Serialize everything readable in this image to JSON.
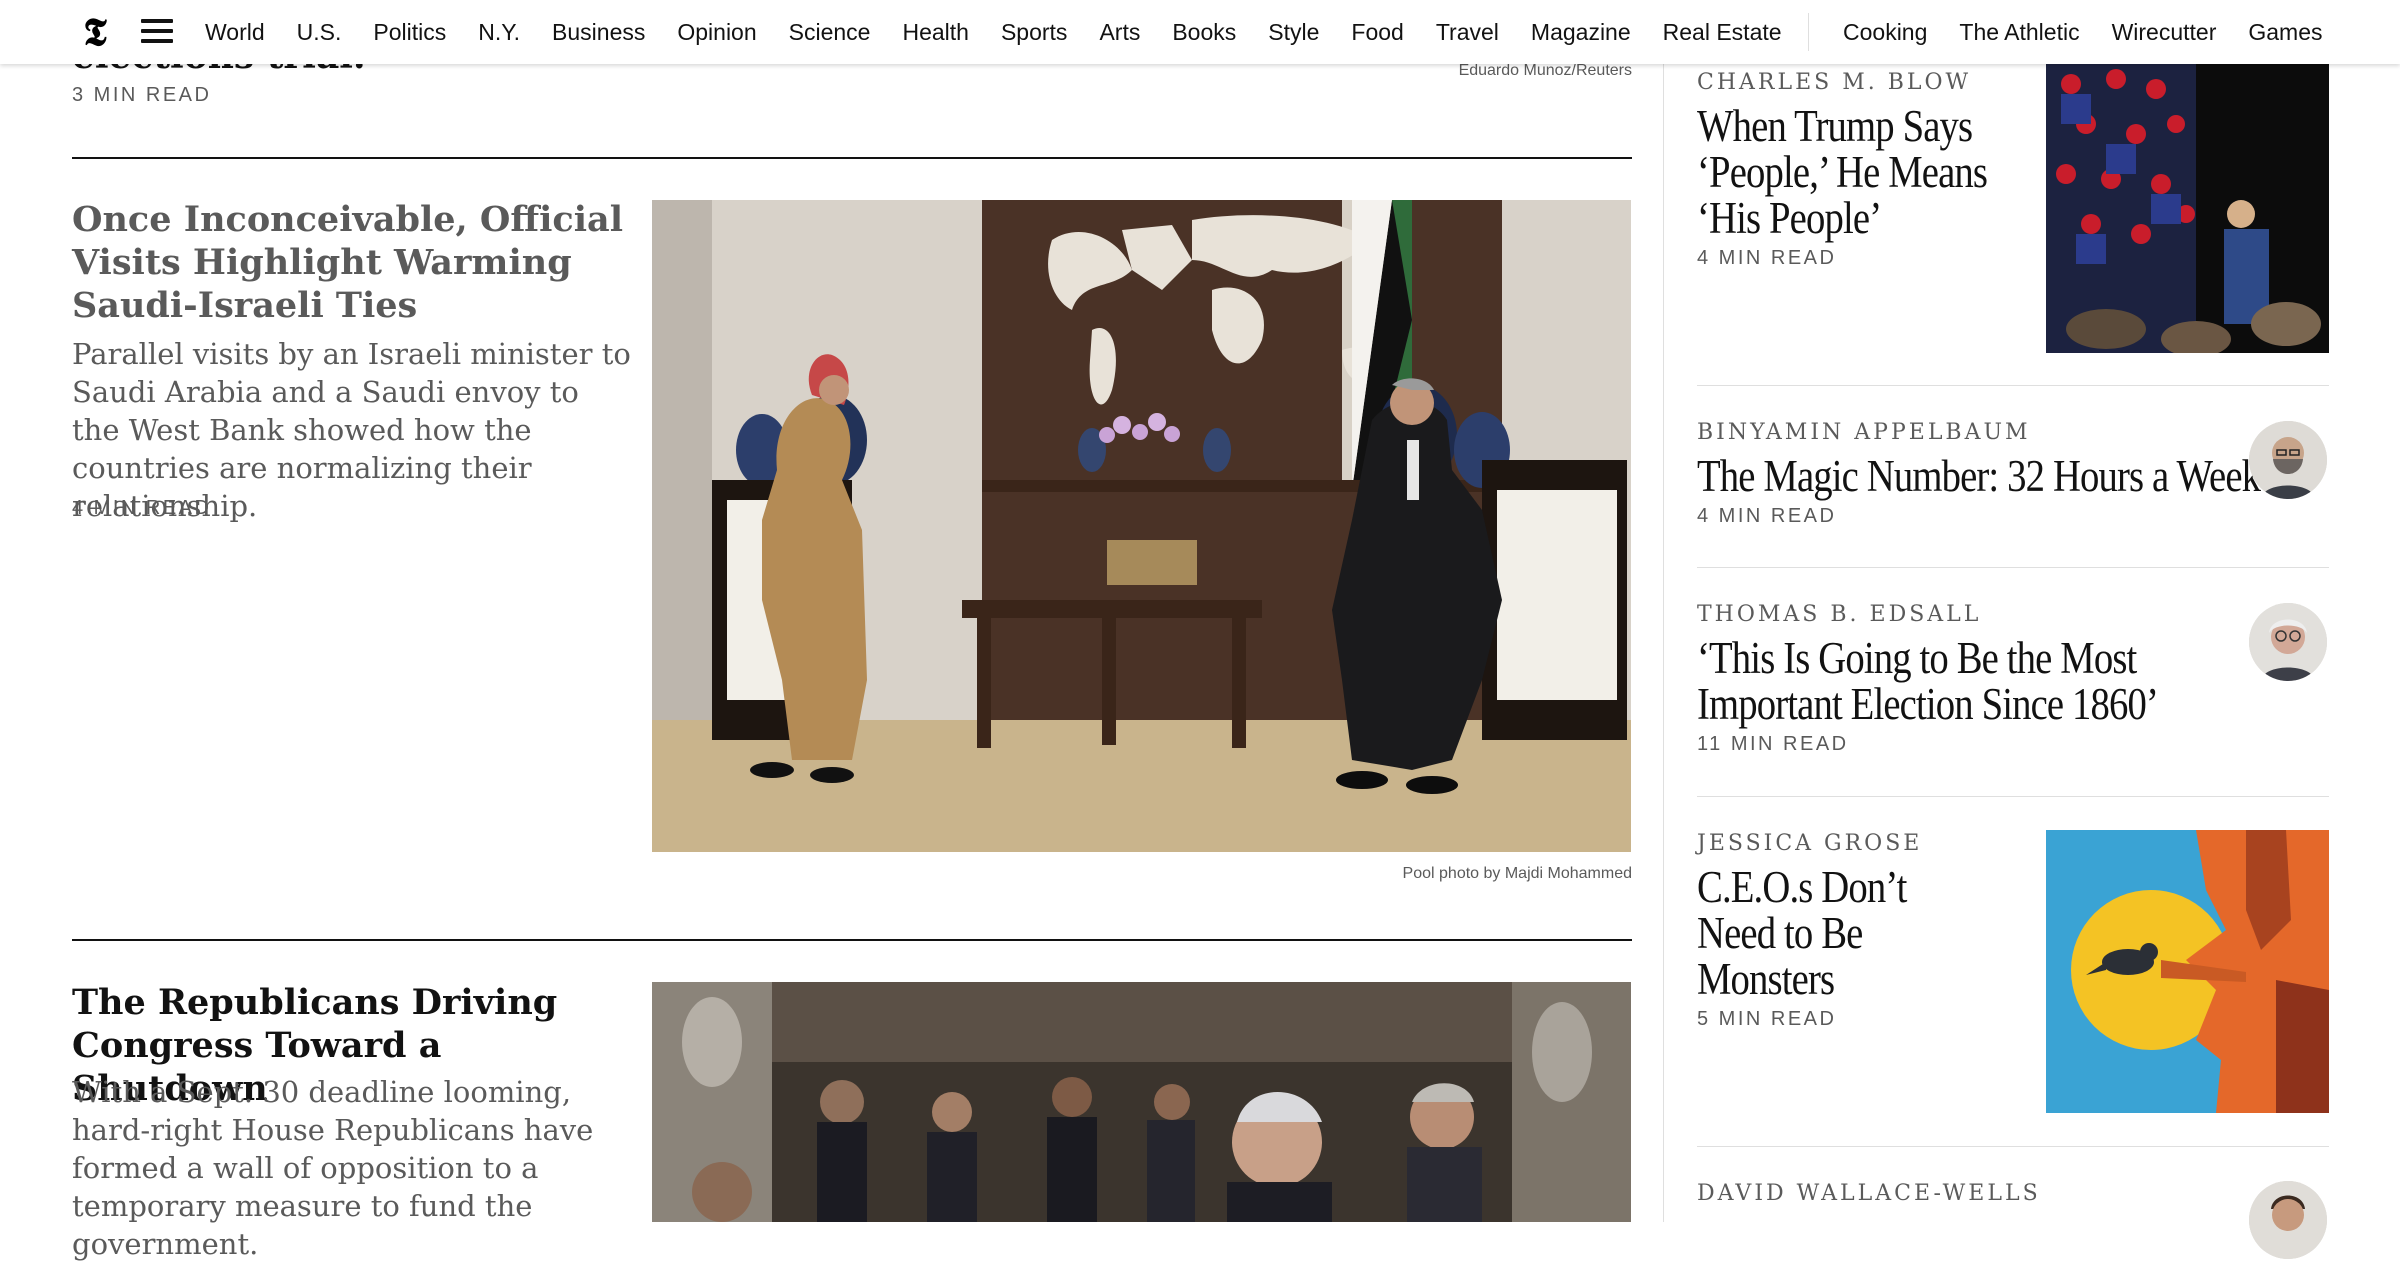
{
  "nav": {
    "logo": "𝕿",
    "left": [
      "World",
      "U.S.",
      "Politics",
      "N.Y.",
      "Business",
      "Opinion",
      "Science",
      "Health",
      "Sports",
      "Arts",
      "Books",
      "Style",
      "Food",
      "Travel",
      "Magazine",
      "Real Estate"
    ],
    "right": [
      "Cooking",
      "The Athletic",
      "Wirecutter",
      "Games"
    ]
  },
  "main": {
    "prev_story": {
      "headline_tail": "elections trial.",
      "read_time": "3 MIN READ",
      "photo_credit": "Eduardo Munoz/Reuters"
    },
    "story1": {
      "headline": "Once Inconceivable, Official Visits Highlight Warming Saudi-Israeli Ties",
      "summary": "Parallel visits by an Israeli minister to Saudi Arabia and a Saudi envoy to the West Bank showed how the countries are normalizing their relationship.",
      "read_time": "4 MIN READ",
      "photo_credit": "Pool photo by Majdi Mohammed"
    },
    "story2": {
      "headline": "The Republicans Driving Congress Toward a Shutdown",
      "summary": "With a Sept. 30 deadline looming, hard-right House Republicans have formed a wall of opposition to a temporary measure to fund the government."
    }
  },
  "opinion": [
    {
      "byline": "CHARLES M. BLOW",
      "headline": "When Trump Says ‘People,’ He Means ‘His People’",
      "read_time": "4 MIN READ"
    },
    {
      "byline": "BINYAMIN APPELBAUM",
      "headline": "The Magic Number: 32 Hours a Week",
      "read_time": "4 MIN READ"
    },
    {
      "byline": "THOMAS B. EDSALL",
      "headline": "‘This Is Going to Be the Most Important Election Since 1860’",
      "read_time": "11 MIN READ"
    },
    {
      "byline": "JESSICA GROSE",
      "headline": "C.E.O.s Don’t Need to Be Monsters",
      "read_time": "5 MIN READ"
    },
    {
      "byline": "DAVID WALLACE-WELLS"
    }
  ],
  "colors": {
    "text": "#121212",
    "secondary": "#5a5a5a",
    "rule": "#121212",
    "light_rule": "#dfdfdf"
  }
}
